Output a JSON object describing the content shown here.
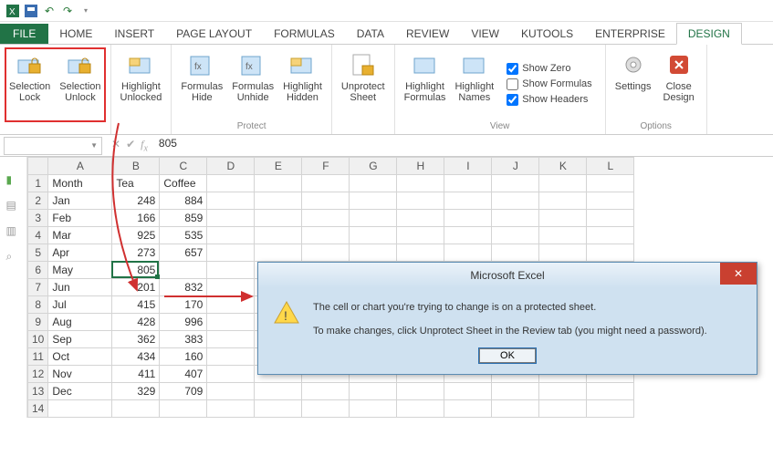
{
  "qat": {
    "icons": [
      "excel",
      "save",
      "undo",
      "redo"
    ]
  },
  "tabs": [
    "FILE",
    "HOME",
    "INSERT",
    "PAGE LAYOUT",
    "FORMULAS",
    "DATA",
    "REVIEW",
    "VIEW",
    "KUTOOLS",
    "ENTERPRISE",
    "DESIGN"
  ],
  "active_tab": "DESIGN",
  "ribbon": {
    "group1": {
      "buttons": [
        {
          "label": "Selection\nLock",
          "icon": "lock"
        },
        {
          "label": "Selection\nUnlock",
          "icon": "unlock"
        }
      ],
      "label": ""
    },
    "group2": {
      "buttons": [
        {
          "label": "Highlight\nUnlocked",
          "icon": "highlight"
        }
      ],
      "label": ""
    },
    "group3": {
      "buttons": [
        {
          "label": "Formulas\nHide",
          "icon": "fhide"
        },
        {
          "label": "Formulas\nUnhide",
          "icon": "funhide"
        },
        {
          "label": "Highlight\nHidden",
          "icon": "hhidden"
        }
      ],
      "label": "Protect"
    },
    "group4": {
      "buttons": [
        {
          "label": "Unprotect\nSheet",
          "icon": "unprotect"
        }
      ],
      "label": ""
    },
    "group5": {
      "buttons": [
        {
          "label": "Highlight\nFormulas",
          "icon": "hformulas"
        },
        {
          "label": "Highlight\nNames",
          "icon": "hnames"
        }
      ],
      "checks": [
        {
          "label": "Show Zero",
          "checked": true
        },
        {
          "label": "Show Formulas",
          "checked": false
        },
        {
          "label": "Show Headers",
          "checked": true
        }
      ],
      "label": "View"
    },
    "group6": {
      "buttons": [
        {
          "label": "Settings",
          "icon": "settings"
        },
        {
          "label": "Close\nDesign",
          "icon": "close"
        }
      ],
      "label": "Options"
    }
  },
  "formula_bar": {
    "name_box": "",
    "formula": "805"
  },
  "columns": [
    "A",
    "B",
    "C",
    "D",
    "E",
    "F",
    "G",
    "H",
    "I",
    "J",
    "K",
    "L"
  ],
  "rows": [
    {
      "n": 1,
      "a": "Month",
      "b": "Tea",
      "c": "Coffee"
    },
    {
      "n": 2,
      "a": "Jan",
      "b": "248",
      "c": "884"
    },
    {
      "n": 3,
      "a": "Feb",
      "b": "166",
      "c": "859"
    },
    {
      "n": 4,
      "a": "Mar",
      "b": "925",
      "c": "535"
    },
    {
      "n": 5,
      "a": "Apr",
      "b": "273",
      "c": "657"
    },
    {
      "n": 6,
      "a": "May",
      "b": "805",
      "c": ""
    },
    {
      "n": 7,
      "a": "Jun",
      "b": "201",
      "c": "832"
    },
    {
      "n": 8,
      "a": "Jul",
      "b": "415",
      "c": "170"
    },
    {
      "n": 9,
      "a": "Aug",
      "b": "428",
      "c": "996"
    },
    {
      "n": 10,
      "a": "Sep",
      "b": "362",
      "c": "383"
    },
    {
      "n": 11,
      "a": "Oct",
      "b": "434",
      "c": "160"
    },
    {
      "n": 12,
      "a": "Nov",
      "b": "411",
      "c": "407"
    },
    {
      "n": 13,
      "a": "Dec",
      "b": "329",
      "c": "709"
    },
    {
      "n": 14,
      "a": "",
      "b": "",
      "c": ""
    }
  ],
  "active_cell": {
    "row": 6,
    "col": "B"
  },
  "dialog": {
    "title": "Microsoft Excel",
    "line1": "The cell or chart you're trying to change is on a protected sheet.",
    "line2": "To make changes, click Unprotect Sheet in the Review tab (you might need a password).",
    "ok": "OK"
  }
}
